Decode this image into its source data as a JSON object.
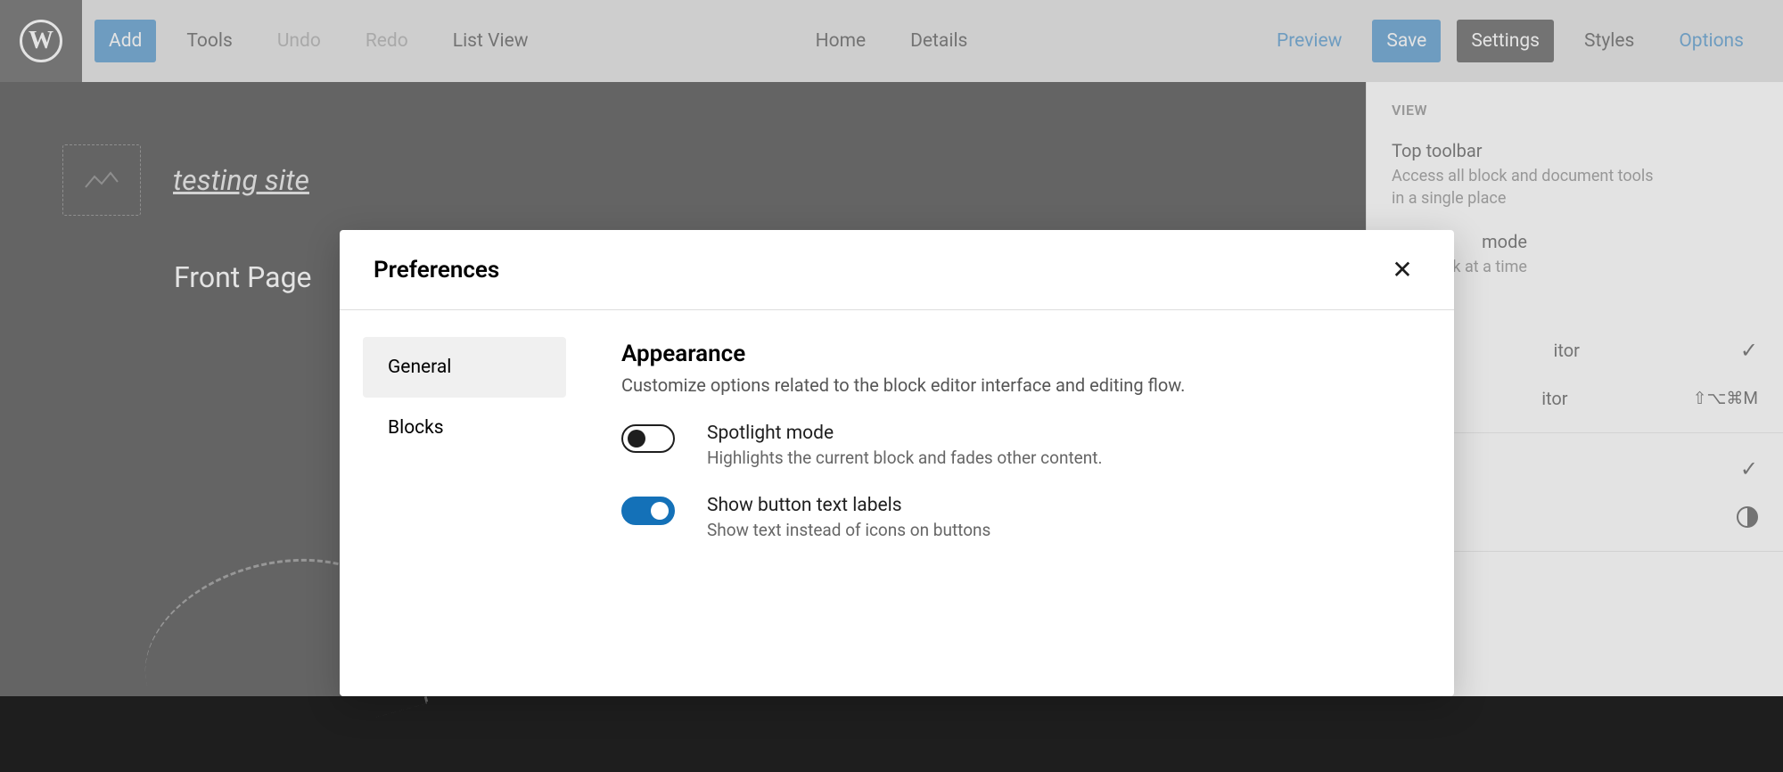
{
  "toolbar": {
    "add": "Add",
    "tools": "Tools",
    "undo": "Undo",
    "redo": "Redo",
    "list_view": "List View",
    "home": "Home",
    "details": "Details",
    "preview": "Preview",
    "save": "Save",
    "settings": "Settings",
    "styles": "Styles",
    "options": "Options"
  },
  "site": {
    "title": "testing site",
    "page_title": "Front Page"
  },
  "side_panel": {
    "section_label": "VIEW",
    "top_toolbar": {
      "title": "Top toolbar",
      "desc": "Access all block and document tools in a single place"
    },
    "mode": {
      "title_fragment": "mode",
      "desc_fragment": "one block at a time"
    },
    "visual_editor": {
      "label_fragment": "itor"
    },
    "code_editor": {
      "label_fragment": "itor",
      "shortcut": "⇧⌥⌘M"
    }
  },
  "modal": {
    "title": "Preferences",
    "nav": {
      "general": "General",
      "blocks": "Blocks"
    },
    "appearance": {
      "heading": "Appearance",
      "desc": "Customize options related to the block editor interface and editing flow.",
      "spotlight": {
        "label": "Spotlight mode",
        "desc": "Highlights the current block and fades other content.",
        "enabled": false
      },
      "text_labels": {
        "label": "Show button text labels",
        "desc": "Show text instead of icons on buttons",
        "enabled": true
      }
    }
  }
}
